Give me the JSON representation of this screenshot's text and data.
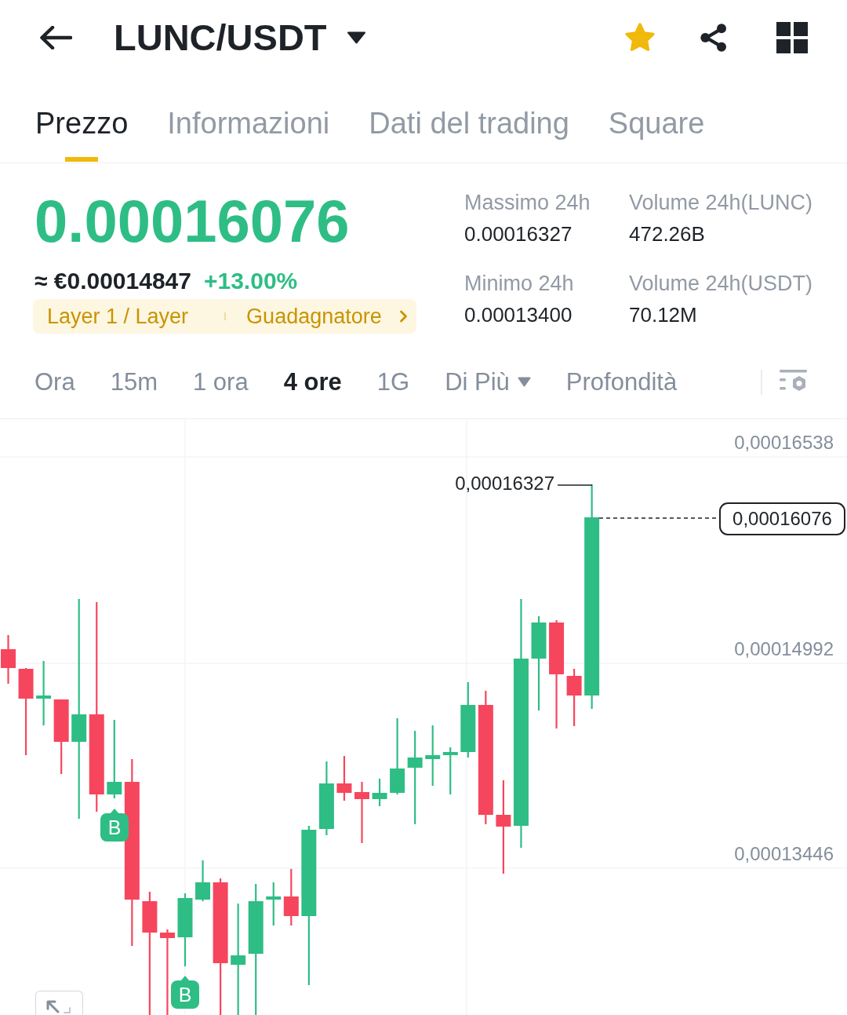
{
  "header": {
    "title": "LUNC/USDT",
    "favorited": true
  },
  "tabs": [
    {
      "label": "Prezzo",
      "selected": true
    },
    {
      "label": "Informazioni",
      "selected": false
    },
    {
      "label": "Dati del trading",
      "selected": false
    },
    {
      "label": "Square",
      "selected": false
    }
  ],
  "price": {
    "last": "0.00016076",
    "fiat": "≈ €0.00014847",
    "change": "+13.00%"
  },
  "tags": [
    "Layer 1 / Layer",
    "Guadagnatore"
  ],
  "stats": [
    {
      "label": "Massimo 24h",
      "value": "0.00016327"
    },
    {
      "label": "Volume 24h(LUNC)",
      "value": "472.26B"
    },
    {
      "label": "Minimo 24h",
      "value": "0.00013400"
    },
    {
      "label": "Volume 24h(USDT)",
      "value": "70.12M"
    }
  ],
  "intervals": [
    {
      "label": "Ora",
      "selected": false,
      "kind": "option"
    },
    {
      "label": "15m",
      "selected": false,
      "kind": "option"
    },
    {
      "label": "1 ora",
      "selected": false,
      "kind": "option"
    },
    {
      "label": "4 ore",
      "selected": true,
      "kind": "option"
    },
    {
      "label": "1G",
      "selected": false,
      "kind": "option"
    },
    {
      "label": "Di Più",
      "selected": false,
      "kind": "menu"
    },
    {
      "label": "Profondità",
      "selected": false,
      "kind": "option"
    }
  ],
  "chart": {
    "y_axis_labels": [
      "0,00016538",
      "0,00014992",
      "0,00013446"
    ],
    "high_label": "0,00016327",
    "last_price_label": "0,00016076",
    "markers": [
      {
        "label": "B"
      },
      {
        "label": "B"
      }
    ]
  }
}
